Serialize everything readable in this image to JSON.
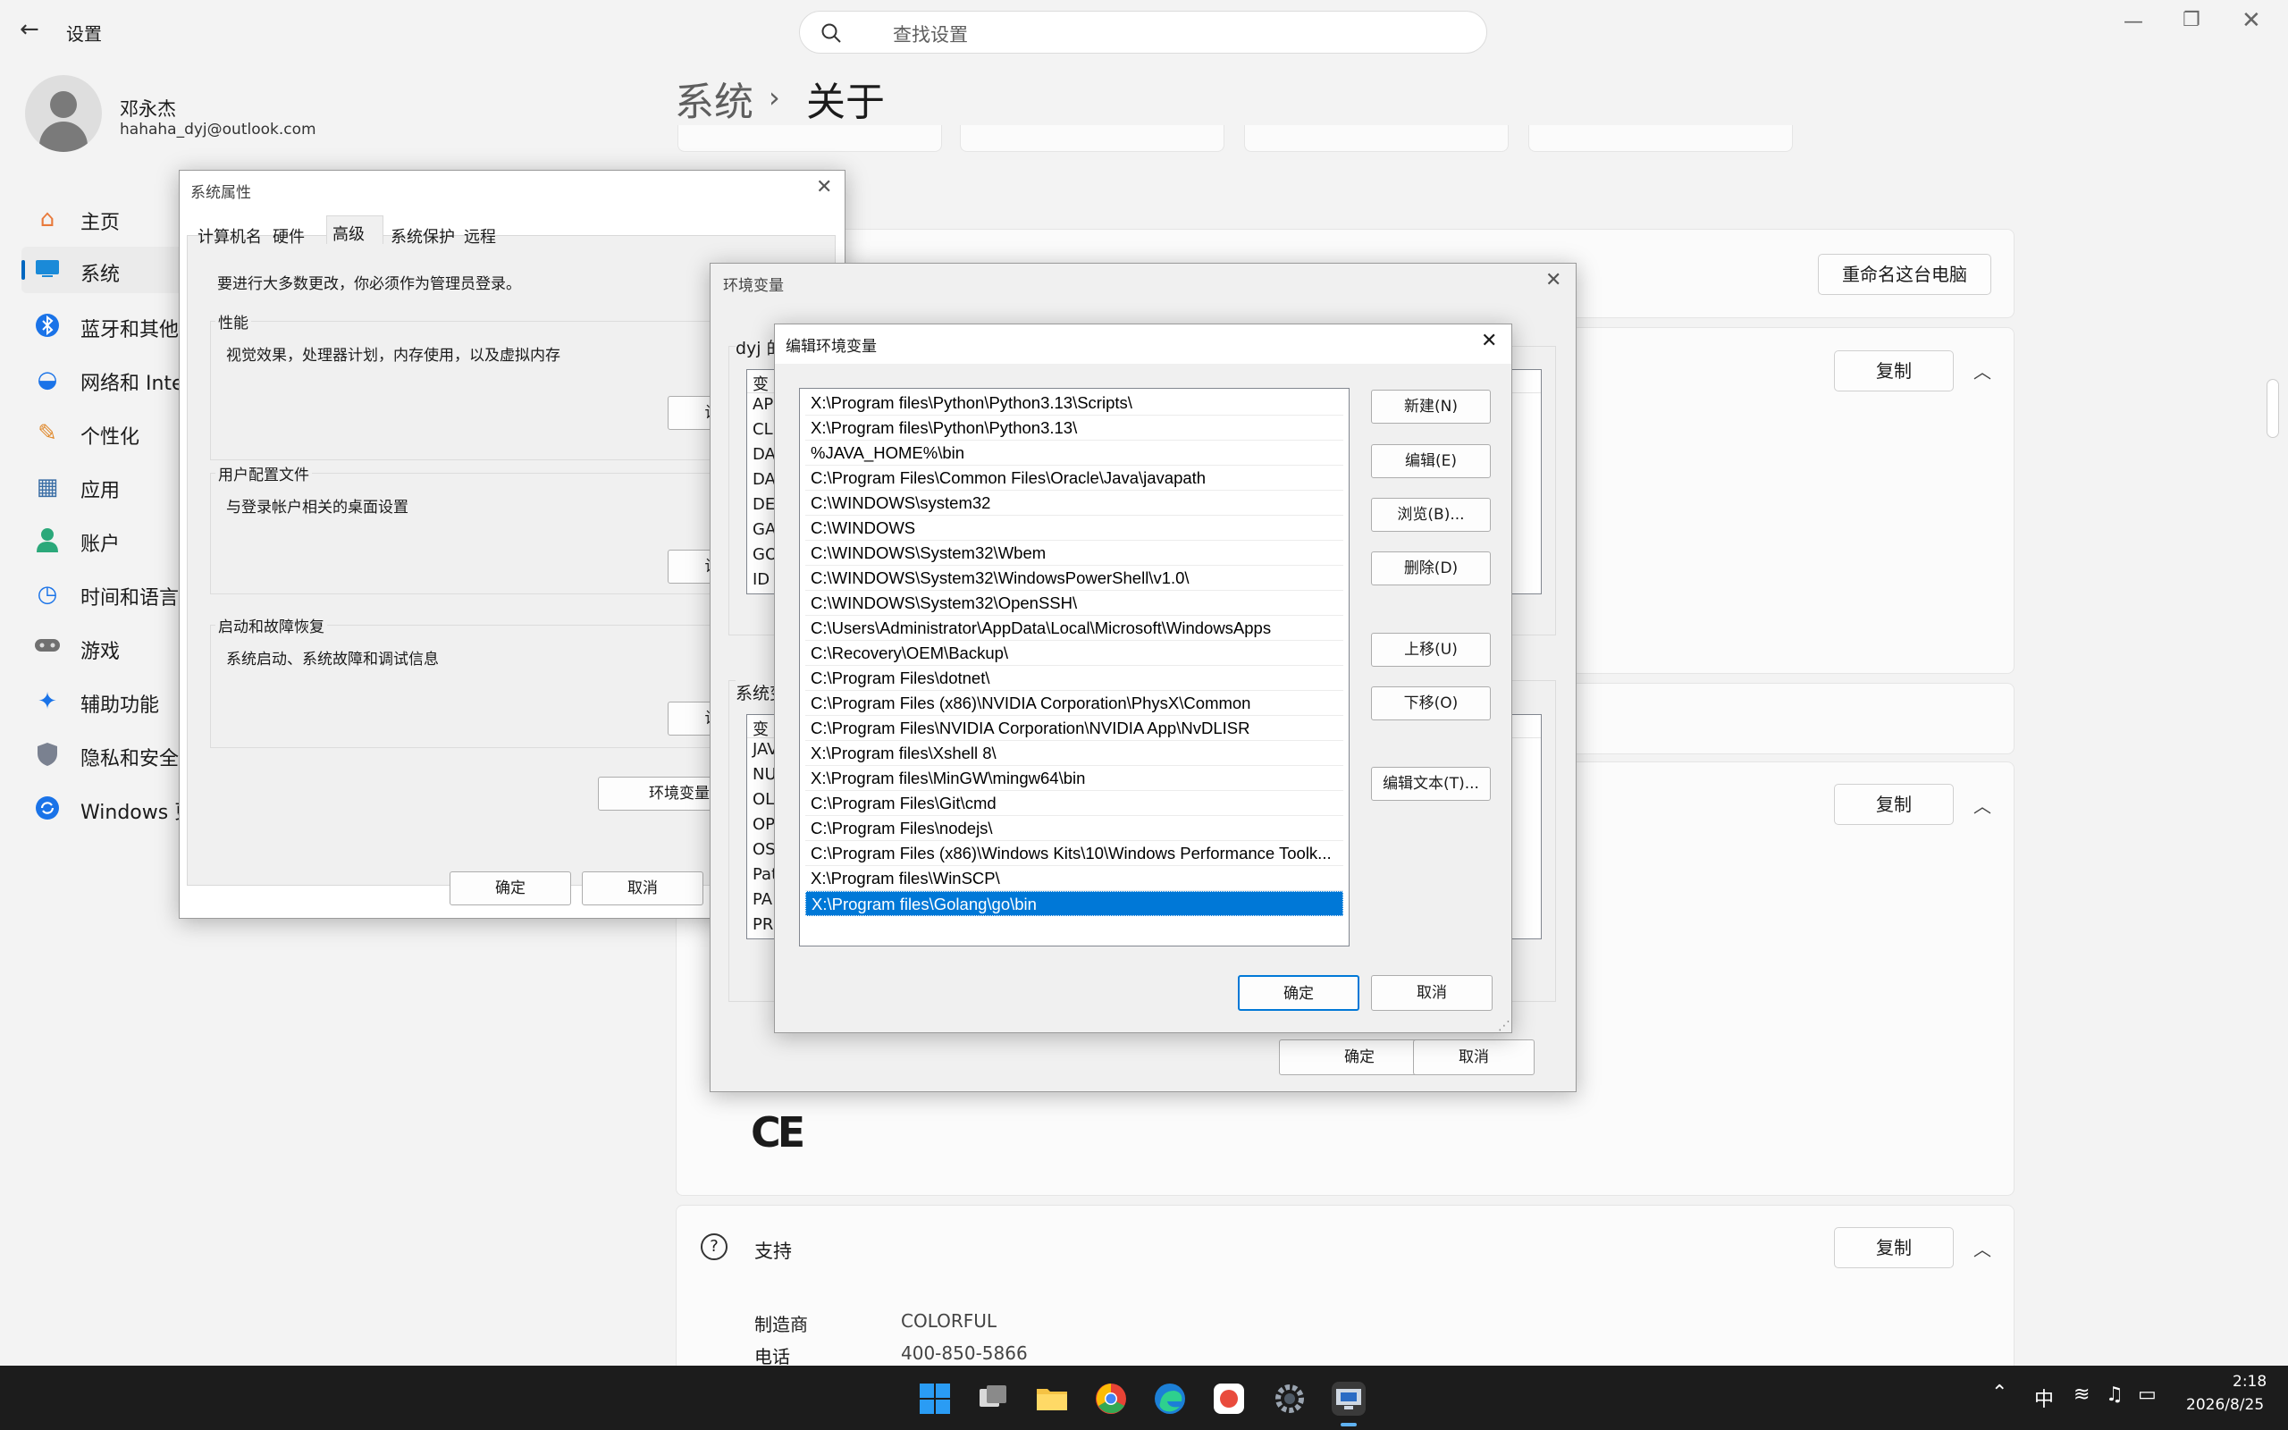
{
  "titlebar": {
    "back_icon": "back-arrow-icon",
    "app_name": "设置",
    "search_placeholder": "查找设置"
  },
  "user": {
    "name": "邓永杰",
    "email": "hahaha_dyj@outlook.com"
  },
  "nav": [
    {
      "label": "主页",
      "icon": "home-icon",
      "color": "#e8793a"
    },
    {
      "label": "系统",
      "icon": "system-icon",
      "color": "#1a8ad8"
    },
    {
      "label": "蓝牙和其他设备",
      "icon": "bluetooth-icon",
      "color": "#1a73e8"
    },
    {
      "label": "网络和 Internet",
      "icon": "wifi-icon",
      "color": "#1a73e8"
    },
    {
      "label": "个性化",
      "icon": "brush-icon",
      "color": "#e08a2e"
    },
    {
      "label": "应用",
      "icon": "apps-icon",
      "color": "#3b6ea5"
    },
    {
      "label": "账户",
      "icon": "account-icon",
      "color": "#2ba87a"
    },
    {
      "label": "时间和语言",
      "icon": "clock-globe-icon",
      "color": "#1a73e8"
    },
    {
      "label": "游戏",
      "icon": "gamepad-icon",
      "color": "#6b6b6b"
    },
    {
      "label": "辅助功能",
      "icon": "accessibility-icon",
      "color": "#1a73e8"
    },
    {
      "label": "隐私和安全性",
      "icon": "shield-icon",
      "color": "#6b7280"
    },
    {
      "label": "Windows 更新",
      "icon": "update-icon",
      "color": "#1a73e8"
    }
  ],
  "page": {
    "breadcrumb_parent": "系统",
    "breadcrumb_current": "关于",
    "rename_button": "重命名这台电脑"
  },
  "cards": {
    "copy_label": "复制",
    "support_title": "支持",
    "support_rows": [
      {
        "label": "制造商",
        "value": "COLORFUL"
      },
      {
        "label": "电话",
        "value": "400-850-5866"
      }
    ],
    "ce_mark": "CE"
  },
  "sysprops": {
    "title": "系统属性",
    "tabs": [
      "计算机名",
      "硬件",
      "高级",
      "系统保护",
      "远程"
    ],
    "admin_note": "要进行大多数更改，你必须作为管理员登录。",
    "perf_title": "性能",
    "perf_desc": "视觉效果，处理器计划，内存使用，以及虚拟内存",
    "perf_btn": "设",
    "profile_title": "用户配置文件",
    "profile_desc": "与登录帐户相关的桌面设置",
    "profile_btn": "设",
    "startup_title": "启动和故障恢复",
    "startup_desc": "系统启动、系统故障和调试信息",
    "startup_btn": "设",
    "envvars_btn": "环境变量",
    "ok": "确定",
    "cancel": "取消"
  },
  "envvars": {
    "title": "环境变量",
    "user_group": "dyj 的",
    "sys_group": "系统变",
    "user_col": "变",
    "user_rows": [
      "AP",
      "CL",
      "DA",
      "DA",
      "DE",
      "GA",
      "GO",
      "ID"
    ],
    "sys_col": "变",
    "sys_rows": [
      "JAV",
      "NU",
      "OL",
      "OP",
      "OS",
      "Pat",
      "PA",
      "PR"
    ],
    "ok": "确定",
    "cancel": "取消"
  },
  "editenv": {
    "title": "编辑环境变量",
    "paths": [
      "X:\\Program files\\Python\\Python3.13\\Scripts\\",
      "X:\\Program files\\Python\\Python3.13\\",
      "%JAVA_HOME%\\bin",
      "C:\\Program Files\\Common Files\\Oracle\\Java\\javapath",
      "C:\\WINDOWS\\system32",
      "C:\\WINDOWS",
      "C:\\WINDOWS\\System32\\Wbem",
      "C:\\WINDOWS\\System32\\WindowsPowerShell\\v1.0\\",
      "C:\\WINDOWS\\System32\\OpenSSH\\",
      "C:\\Users\\Administrator\\AppData\\Local\\Microsoft\\WindowsApps",
      "C:\\Recovery\\OEM\\Backup\\",
      "C:\\Program Files\\dotnet\\",
      "C:\\Program Files (x86)\\NVIDIA Corporation\\PhysX\\Common",
      "C:\\Program Files\\NVIDIA Corporation\\NVIDIA App\\NvDLISR",
      "X:\\Program files\\Xshell 8\\",
      "X:\\Program files\\MinGW\\mingw64\\bin",
      "C:\\Program Files\\Git\\cmd",
      "C:\\Program Files\\nodejs\\",
      "C:\\Program Files (x86)\\Windows Kits\\10\\Windows Performance Toolk...",
      "X:\\Program files\\WinSCP\\",
      "X:\\Program files\\Golang\\go\\bin"
    ],
    "selected_index": 20,
    "btn_new": "新建(N)",
    "btn_edit": "编辑(E)",
    "btn_browse": "浏览(B)...",
    "btn_delete": "删除(D)",
    "btn_up": "上移(U)",
    "btn_down": "下移(O)",
    "btn_edit_text": "编辑文本(T)...",
    "ok": "确定",
    "cancel": "取消"
  },
  "taskbar": {
    "apps": [
      "start-icon",
      "task-view-icon",
      "file-explorer-icon",
      "chrome-icon",
      "edge-icon",
      "app-icon",
      "settings-icon",
      "remote-desktop-icon"
    ],
    "ime": "中",
    "time": "2:18",
    "date": "2026/8/25"
  }
}
